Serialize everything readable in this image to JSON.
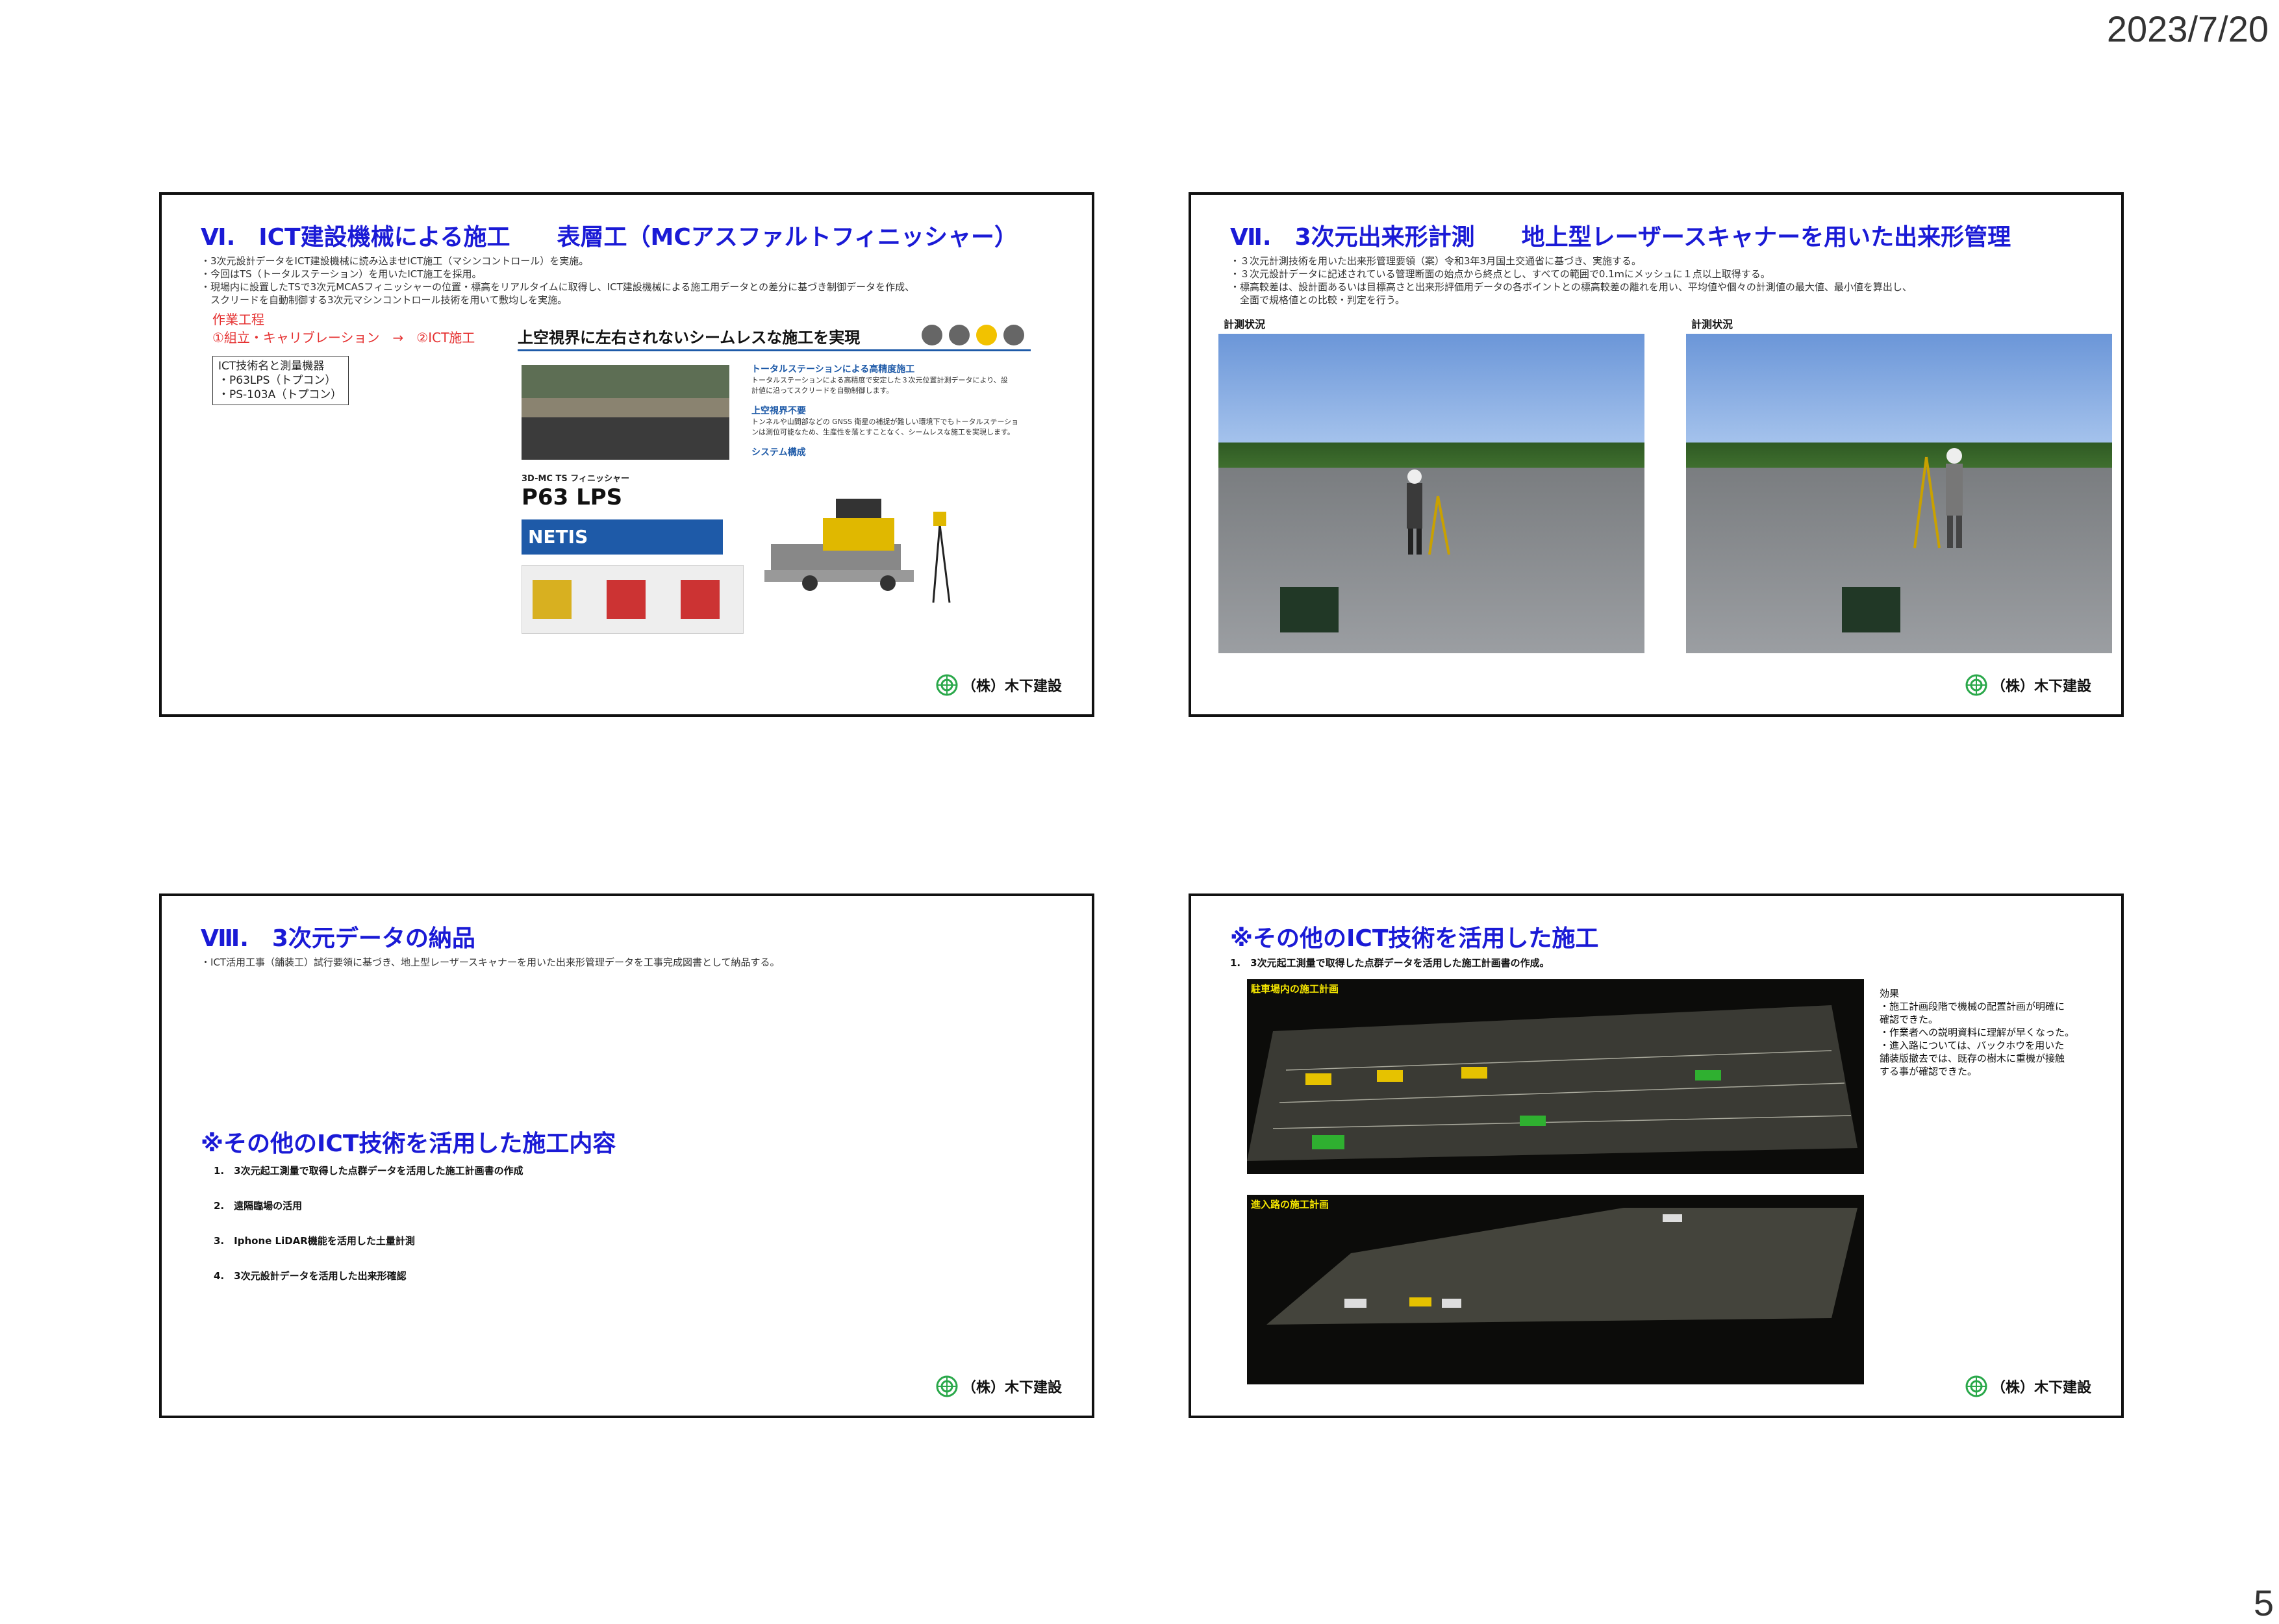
{
  "date": "2023/7/20",
  "page_number": "5",
  "company": "（株）木下建設",
  "slide1": {
    "title": "Ⅵ.　ICT建設機械による施工　　表層工（MCアスファルトフィニッシャー）",
    "bullets": [
      "・3次元設計データをICT建設機械に読み込ませICT施工（マシンコントロール）を実施。",
      "・今回はTS（トータルステーション）を用いたICT施工を採用。",
      "・現場内に設置したTSで3次元MCASフィニッシャーの位置・標高をリアルタイムに取得し、ICT建設機械による施工用データとの差分に基づき制御データを作成、",
      "　スクリードを自動制御する3次元マシンコントロール技術を用いて敷均しを実施。"
    ],
    "work_label": "作業工程",
    "work_steps": "①組立・キャリブレーション　→　②ICT施工",
    "box_lines": [
      "ICT技術名と測量機器",
      "・P63LPS（トプコン）",
      "・PS-103A（トプコン）"
    ],
    "brochure_title": "上空視界に左右されないシームレスな施工を実現",
    "product_sub": "3D-MC TS フィニッシャー",
    "product_name": "P63 LPS",
    "netis": "NETIS",
    "feature1_title": "トータルステーションによる高精度施工",
    "feature1_text": "トータルステーションによる高精度で安定した３次元位置計測データにより、設\n計値に沿ってスクリードを自動制御します。",
    "feature2_title": "上空視界不要",
    "feature2_text": "トンネルや山間部などの GNSS 衛星の補捉が難しい環境下でもトータルステーショ\nンは測位可能なため、生産性を落とすことなく、シームレスな施工を実現します。",
    "feature3_title": "システム構成"
  },
  "slide2": {
    "title": "Ⅶ.　3次元出来形計測　　地上型レーザースキャナーを用いた出来形管理",
    "bullets": [
      "・３次元計測技術を用いた出来形管理要領（案）令和3年3月国土交通省に基づき、実施する。",
      "・３次元設計データに記述されている管理断面の始点から終点とし、すべての範囲で0.1ｍにメッシュに１点以上取得する。",
      "・標高較差は、設計面あるいは目標高さと出来形評価用データの各ポイントとの標高較差の離れを用い、平均値や個々の計測値の最大値、最小値を算出し、",
      "　全面で規格値との比較・判定を行う。"
    ],
    "caption_left": "計測状況",
    "caption_right": "計測状況"
  },
  "slide3": {
    "title": "Ⅷ.　3次元データの納品",
    "bullet": "・ICT活用工事（舗装工）試行要領に基づき、地上型レーザースキャナーを用いた出来形管理データを工事完成図書として納品する。",
    "subtitle": "※その他のICT技術を活用した施工内容",
    "items": [
      "1.　3次元起工測量で取得した点群データを活用した施工計画書の作成",
      "2.　遠隔臨場の活用",
      "3.　Iphone LiDAR機能を活用した土量計測",
      "4.　3次元設計データを活用した出来形確認"
    ]
  },
  "slide4": {
    "title": "※その他のICT技術を活用した施工",
    "item": "1.　3次元起工測量で取得した点群データを活用した施工計画書の作成。",
    "img1_label": "駐車場内の施工計画",
    "img2_label": "進入路の施工計画",
    "effect": "効果\n・施工計画段階で機械の配置計画が明確に\n確認できた。\n・作業者への説明資料に理解が早くなった。\n・進入路については、バックホウを用いた\n舗装版撤去では、既存の樹木に重機が接触\nする事が確認できた。"
  },
  "colors": {
    "title_blue": "#1a1ad6",
    "red": "#e53030"
  }
}
